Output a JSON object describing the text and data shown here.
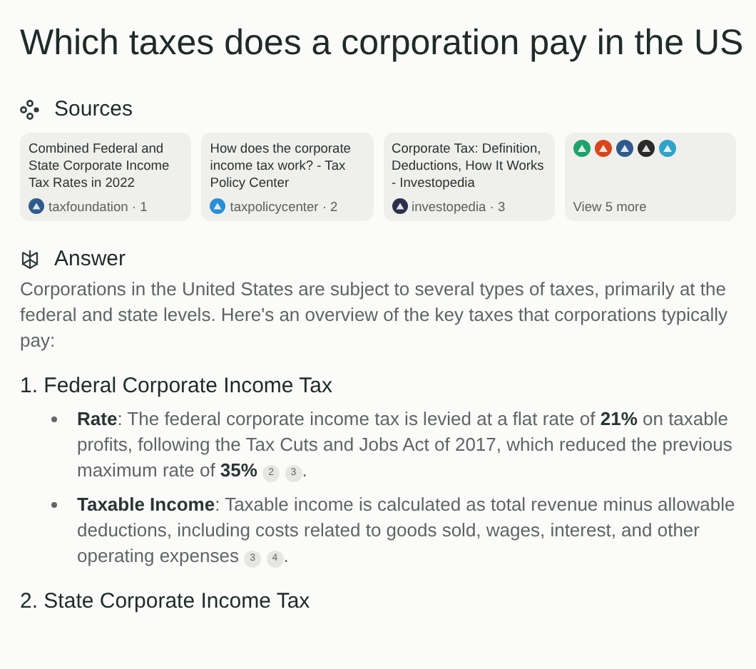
{
  "title": "Which taxes does a corporation pay in the US",
  "sources": {
    "heading": "Sources",
    "cards": [
      {
        "kind": "source",
        "title": "Combined Federal and State Corporate Income Tax Rates in 2022",
        "site": "taxfoundation · 1",
        "color": "#2f5a8c"
      },
      {
        "kind": "source",
        "title": "How does the corporate income tax work? - Tax Policy Center",
        "site": "taxpolicycenter · 2",
        "color": "#2a8fd6"
      },
      {
        "kind": "source",
        "title": "Corporate Tax: Definition, Deductions, How It Works - Investopedia",
        "site": "investopedia · 3",
        "color": "#2b2f4a"
      },
      {
        "kind": "more",
        "label": "View 5 more",
        "icons": [
          {
            "color": "#1fa36b"
          },
          {
            "color": "#d9461c"
          },
          {
            "color": "#2f5a8c"
          },
          {
            "color": "#2a2a2a"
          },
          {
            "color": "#2fa3c8"
          }
        ]
      }
    ]
  },
  "answer": {
    "heading": "Answer",
    "intro": "Corporations in the United States are subject to several types of taxes, primarily at the federal and state levels. Here's an overview of the key taxes that corporations typically pay:",
    "sections": [
      {
        "heading": "1. Federal Corporate Income Tax",
        "bullets": [
          {
            "text": "**Rate**: The federal corporate income tax is levied at a flat rate of **21%** on taxable profits, following the Tax Cuts and Jobs Act of 2017, which reduced the previous maximum rate of **35%**",
            "citations": [
              "2",
              "3"
            ],
            "end": "."
          },
          {
            "text": "**Taxable Income**: Taxable income is calculated as total revenue minus allowable deductions, including costs related to goods sold, wages, interest, and other operating expenses",
            "citations": [
              "3",
              "4"
            ],
            "end": "."
          }
        ]
      },
      {
        "heading": "2. State Corporate Income Tax"
      }
    ]
  }
}
